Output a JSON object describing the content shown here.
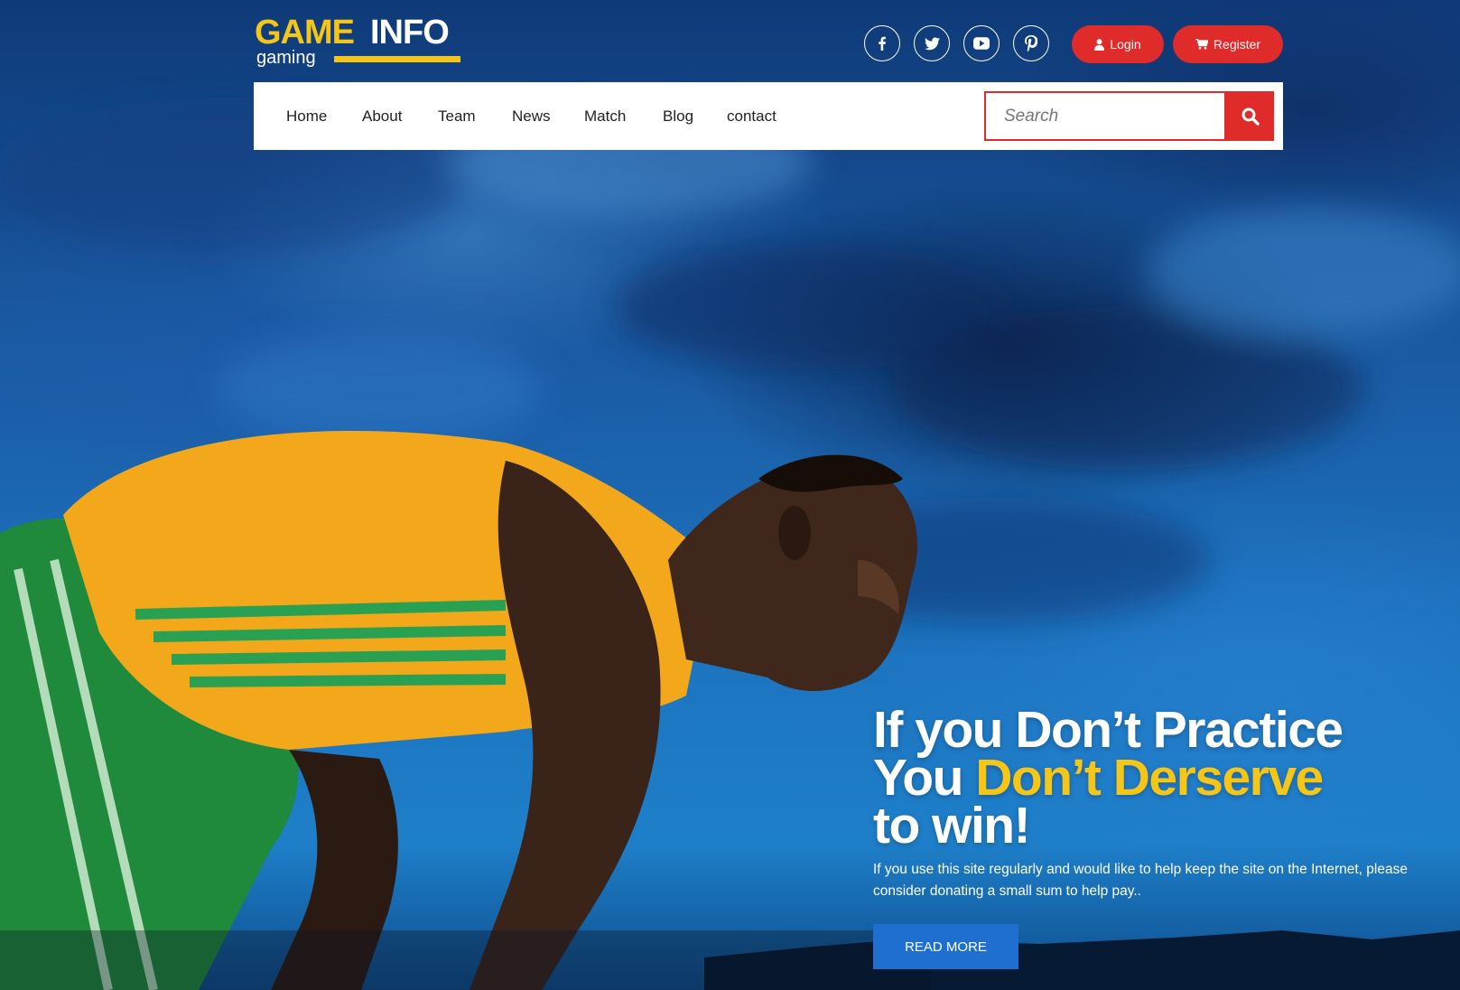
{
  "brand": {
    "name_part1": "GAME",
    "name_part2": "INFO",
    "tagline": "gaming",
    "accent_color": "#f5c518"
  },
  "social": [
    {
      "icon": "facebook-icon"
    },
    {
      "icon": "twitter-icon"
    },
    {
      "icon": "youtube-icon"
    },
    {
      "icon": "pinterest-icon"
    }
  ],
  "auth": {
    "login_label": "Login",
    "register_label": "Register",
    "button_color": "#e02b2b"
  },
  "nav": {
    "items": [
      "Home",
      "About",
      "Team",
      "News",
      "Match",
      "Blog",
      "contact"
    ]
  },
  "search": {
    "placeholder": "Search",
    "icon": "search-icon"
  },
  "hero": {
    "headline_line1": "If you Don’t Practice",
    "headline_line2_white": "You ",
    "headline_line2_yellow": "Don’t Derserve",
    "headline_line3": "to win!",
    "description": "If you use this site regularly and would like to help keep the site on the Internet, please consider donating a small sum to help pay..",
    "cta_label": "READ MORE",
    "cta_color": "#1f6fd1"
  }
}
